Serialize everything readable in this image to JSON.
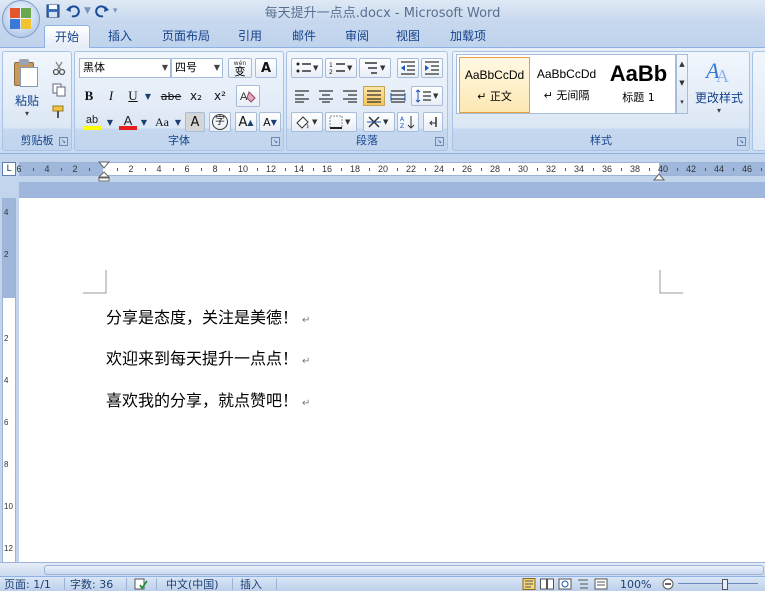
{
  "window": {
    "title": "每天提升一点点.docx - Microsoft Word"
  },
  "qat": {
    "save_icon": "save-icon",
    "undo_icon": "undo-icon",
    "redo_icon": "redo-icon"
  },
  "tabs": [
    {
      "label": "开始",
      "active": true
    },
    {
      "label": "插入"
    },
    {
      "label": "页面布局"
    },
    {
      "label": "引用"
    },
    {
      "label": "邮件"
    },
    {
      "label": "审阅"
    },
    {
      "label": "视图"
    },
    {
      "label": "加载项"
    }
  ],
  "ribbon": {
    "clipboard": {
      "label": "剪贴板",
      "paste_label": "粘贴"
    },
    "font": {
      "label": "字体",
      "font_name": "黑体",
      "font_size": "四号",
      "bold": "B",
      "italic": "I",
      "underline": "U",
      "strike": "abe",
      "subscript": "x₂",
      "superscript": "x²",
      "change_case": "Aa",
      "char_border": "A",
      "grow": "A",
      "shrink": "A",
      "wen_label": "wén",
      "wen_char": "变",
      "enclose_char": "字",
      "highlight": "ab",
      "font_color": "A",
      "char_shading": "A"
    },
    "paragraph": {
      "label": "段落"
    },
    "styles": {
      "label": "样式",
      "items": [
        {
          "sample": "AaBbCcDd",
          "name": "↵ 正文",
          "selected": true
        },
        {
          "sample": "AaBbCcDd",
          "name": "↵ 无间隔"
        },
        {
          "sample": "AaBb",
          "name": "标题 1"
        }
      ],
      "change_styles": "更改样式"
    }
  },
  "ruler": {
    "h_numbers": [
      "6",
      "4",
      "2",
      "",
      "2",
      "4",
      "6",
      "8",
      "10",
      "12",
      "14",
      "16",
      "18",
      "20",
      "22",
      "24",
      "26",
      "28",
      "30",
      "32",
      "34",
      "36",
      "38",
      "40",
      "42",
      "44",
      "46"
    ],
    "v_numbers": [
      "4",
      "2",
      "",
      "2",
      "4",
      "6",
      "8",
      "10",
      "12"
    ],
    "tab_selector": "L"
  },
  "document": {
    "paragraphs": [
      "分享是态度，关注是美德！",
      "欢迎来到每天提升一点点！",
      "喜欢我的分享，就点赞吧！"
    ],
    "para_mark": "↵"
  },
  "status": {
    "page": "页面: 1/1",
    "words": "字数: 36",
    "language": "中文(中国)",
    "mode": "插入",
    "zoom": "100%"
  }
}
